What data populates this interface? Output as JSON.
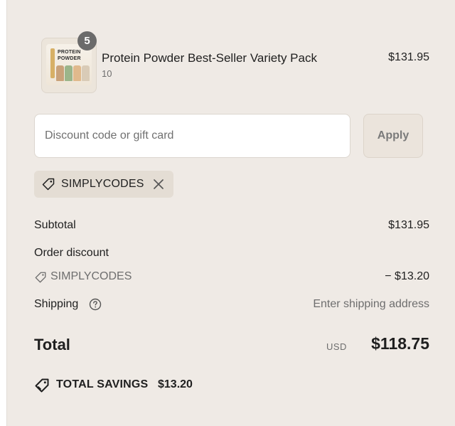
{
  "line_item": {
    "quantity_badge": "5",
    "name": "Protein Powder Best-Seller Variety Pack",
    "variant": "10",
    "price": "$131.95",
    "image_label_line1": "PROTEIN",
    "image_label_line2": "POWDER"
  },
  "discount": {
    "placeholder": "Discount code or gift card",
    "value": "",
    "apply_label": "Apply",
    "applied_code": "SIMPLYCODES"
  },
  "summary": {
    "subtotal_label": "Subtotal",
    "subtotal_value": "$131.95",
    "order_discount_label": "Order discount",
    "discount_code": "SIMPLYCODES",
    "discount_value": "− $13.20",
    "shipping_label": "Shipping",
    "shipping_value": "Enter shipping address",
    "total_label": "Total",
    "total_currency": "USD",
    "total_value": "$118.75",
    "savings_label": "TOTAL SAVINGS",
    "savings_value": "$13.20"
  },
  "colors": {
    "panel_bg": "#efeae5",
    "badge_bg": "#6b6b6b",
    "chip_bg": "#e4ddd4"
  },
  "icons": [
    "tag-icon",
    "close-icon",
    "help-circle-icon",
    "savings-tag-icon"
  ]
}
